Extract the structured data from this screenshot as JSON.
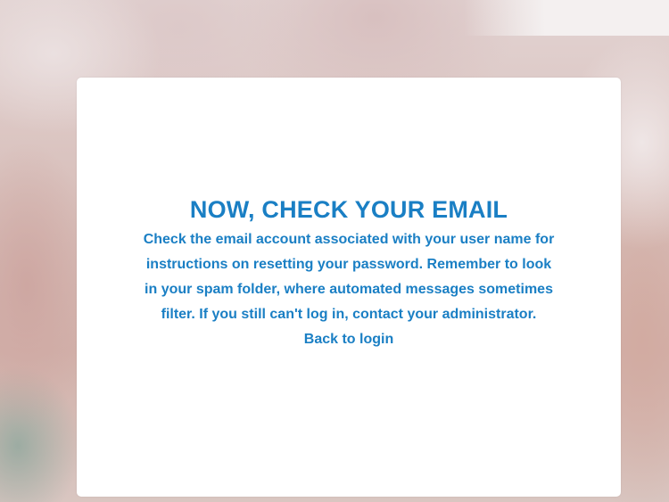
{
  "dialog": {
    "title": "NOW, CHECK YOUR EMAIL",
    "message": "Check the email account associated with your user name for instructions on resetting your password. Remember to look in your spam folder, where automated messages sometimes filter. If you still can't log in, contact your administrator.",
    "back_link_label": "Back to login"
  },
  "colors": {
    "accent": "#1a7fc4",
    "card_background": "#ffffff"
  }
}
